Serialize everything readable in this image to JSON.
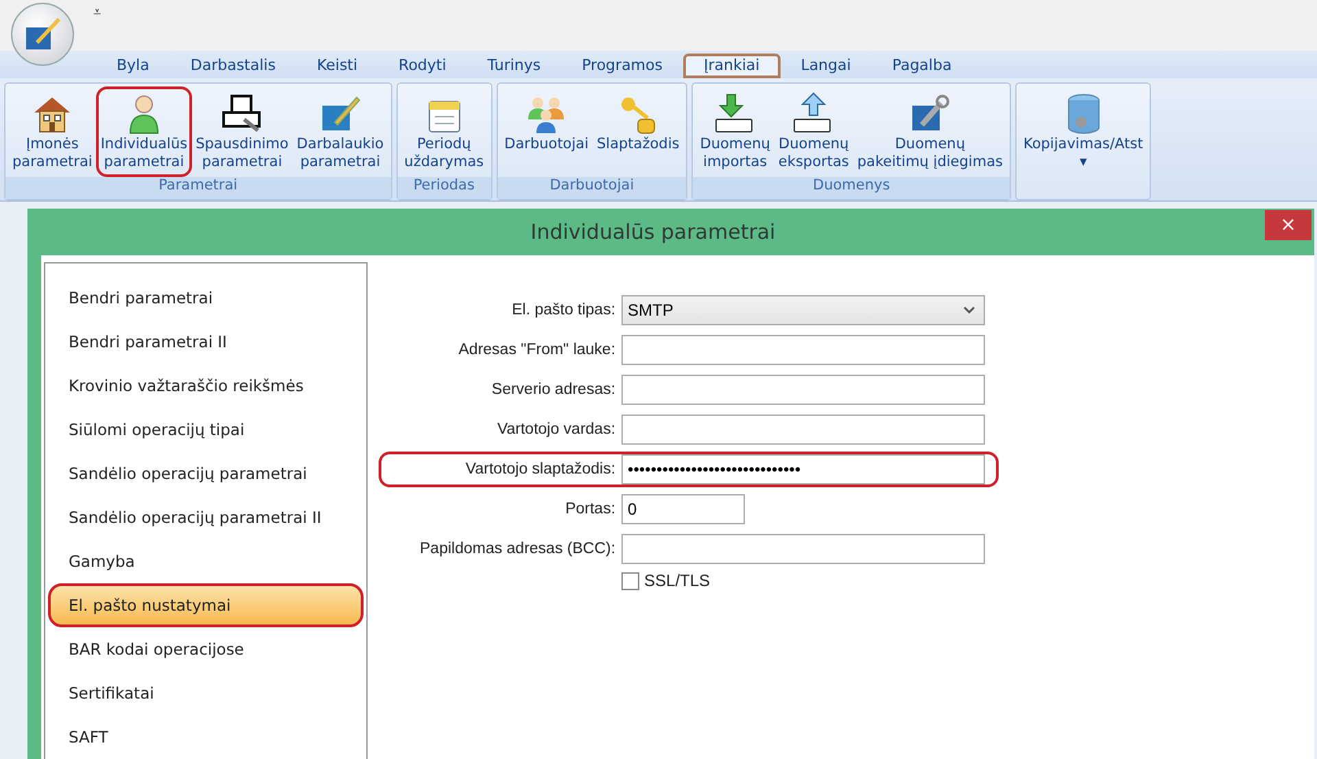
{
  "app": {
    "quick_access": "⩡"
  },
  "menu": [
    {
      "label": "Byla",
      "selected": false
    },
    {
      "label": "Darbastalis",
      "selected": false
    },
    {
      "label": "Keisti",
      "selected": false
    },
    {
      "label": "Rodyti",
      "selected": false
    },
    {
      "label": "Turinys",
      "selected": false
    },
    {
      "label": "Programos",
      "selected": false
    },
    {
      "label": "Įrankiai",
      "selected": true
    },
    {
      "label": "Langai",
      "selected": false
    },
    {
      "label": "Pagalba",
      "selected": false
    }
  ],
  "ribbon": [
    {
      "label": "Parametrai",
      "buttons": [
        {
          "lines": [
            "Įmonės",
            "parametrai"
          ],
          "highlighted": false
        },
        {
          "lines": [
            "Individualūs",
            "parametrai"
          ],
          "highlighted": true
        },
        {
          "lines": [
            "Spausdinimo",
            "parametrai"
          ],
          "highlighted": false
        },
        {
          "lines": [
            "Darbalaukio",
            "parametrai"
          ],
          "highlighted": false
        }
      ]
    },
    {
      "label": "Periodas",
      "buttons": [
        {
          "lines": [
            "Periodų",
            "uždarymas"
          ],
          "highlighted": false
        }
      ]
    },
    {
      "label": "Darbuotojai",
      "buttons": [
        {
          "lines": [
            "Darbuotojai"
          ],
          "highlighted": false
        },
        {
          "lines": [
            "Slaptažodis"
          ],
          "highlighted": false
        }
      ]
    },
    {
      "label": "Duomenys",
      "buttons": [
        {
          "lines": [
            "Duomenų",
            "importas"
          ],
          "highlighted": false
        },
        {
          "lines": [
            "Duomenų",
            "eksportas"
          ],
          "highlighted": false
        },
        {
          "lines": [
            "Duomenų",
            "pakeitimų įdiegimas"
          ],
          "highlighted": false
        }
      ]
    },
    {
      "buttons": [
        {
          "lines": [
            "Kopijavimas/Atst",
            "▾"
          ],
          "highlighted": false
        }
      ]
    }
  ],
  "dialog": {
    "title": "Individualūs parametrai",
    "close": "×",
    "sections": [
      {
        "label": "Bendri parametrai",
        "selected": false
      },
      {
        "label": "Bendri parametrai II",
        "selected": false
      },
      {
        "label": "Krovinio važtaraščio reikšmės",
        "selected": false
      },
      {
        "label": "Siūlomi operacijų tipai",
        "selected": false
      },
      {
        "label": "Sandėlio operacijų parametrai",
        "selected": false
      },
      {
        "label": "Sandėlio operacijų parametrai II",
        "selected": false
      },
      {
        "label": "Gamyba",
        "selected": false
      },
      {
        "label": "El. pašto nustatymai",
        "selected": true
      },
      {
        "label": "BAR kodai operacijose",
        "selected": false
      },
      {
        "label": "Sertifikatai",
        "selected": false
      },
      {
        "label": "SAFT",
        "selected": false
      }
    ],
    "fields": [
      {
        "kind": "select",
        "label": "El. pašto tipas:",
        "value": "SMTP",
        "highlighted": false
      },
      {
        "kind": "text",
        "label": "Adresas \"From\" lauke:",
        "highlighted": false
      },
      {
        "kind": "text",
        "label": "Serverio adresas:",
        "highlighted": false
      },
      {
        "kind": "text",
        "label": "Vartotojo vardas:",
        "highlighted": false
      },
      {
        "kind": "text",
        "label": "Vartotojo slaptažodis:",
        "value": "••••••••••••••••••••••••••••••",
        "highlighted": true
      },
      {
        "kind": "short",
        "label": "Portas:",
        "value": "0",
        "highlighted": false
      },
      {
        "kind": "text",
        "label": "Papildomas adresas (BCC):",
        "highlighted": false
      },
      {
        "kind": "checkbox",
        "label": "SSL/TLS",
        "checked": false
      }
    ]
  }
}
